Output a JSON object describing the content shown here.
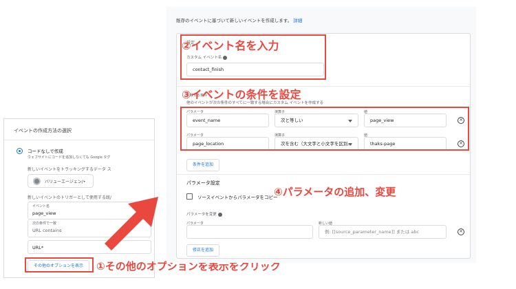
{
  "left_panel": {
    "title": "イベントの作成方法の選択",
    "option_title": "コードなしで作成",
    "option_sub": "ウェブサイトにコードを追加しなくても Google タグ",
    "section_track": "新しいイベントをトラッキングするデータ ス",
    "stream_chip": "バリューエージェン/•",
    "section_trigger": "新しいイベントのトリガーとして使用する既/",
    "field_event_name_label": "イベント名",
    "field_event_name_value": "page_view",
    "field_condition_label": "次の条件で一致",
    "field_condition_value": "URL contains",
    "field_url_value": "URL*",
    "more_options_button": "その他のオプションを表示"
  },
  "main_panel": {
    "header_text": "既存のイベントに基づいて新しいイベントを作成します。",
    "header_link": "詳細",
    "setting_label": "設定",
    "custom_event_label": "カスタム イベント名",
    "custom_event_value": "contact_finish",
    "conditions_label": "一致する条件",
    "conditions_sub": "他のイベントが次の条件のすべてに一致する場合にカスタム イベントを作成する",
    "col_param": "パラメータ",
    "col_operator": "演算子",
    "col_value": "値",
    "rows": [
      {
        "param": "event_name",
        "operator": "次と等しい",
        "value": "page_view"
      },
      {
        "param": "page_location",
        "operator": "次を含む（大文字と小文字を区別...",
        "value": "thaks-page"
      }
    ],
    "add_condition_button": "条件を追加",
    "param_settings_title": "パラメータ設定",
    "copy_params_label": "ソースイベントからパラメータをコピー",
    "param_modify_label": "パラメータを変更",
    "modify_col_param": "パラメータ",
    "modify_col_new_value": "新しい値",
    "modify_new_value_placeholder": "例: [[source_parameter_name]] または abc",
    "add_modification_button": "修正を追加"
  },
  "annotations": {
    "step1": "①その他のオプションを表示をクリック",
    "step2": "②イベント名を入力",
    "step3": "③イベントの条件を設定",
    "step4": "④パラメータの追加、変更"
  },
  "colors": {
    "annotation_red": "#e8483e",
    "link_blue": "#1a73e8"
  }
}
